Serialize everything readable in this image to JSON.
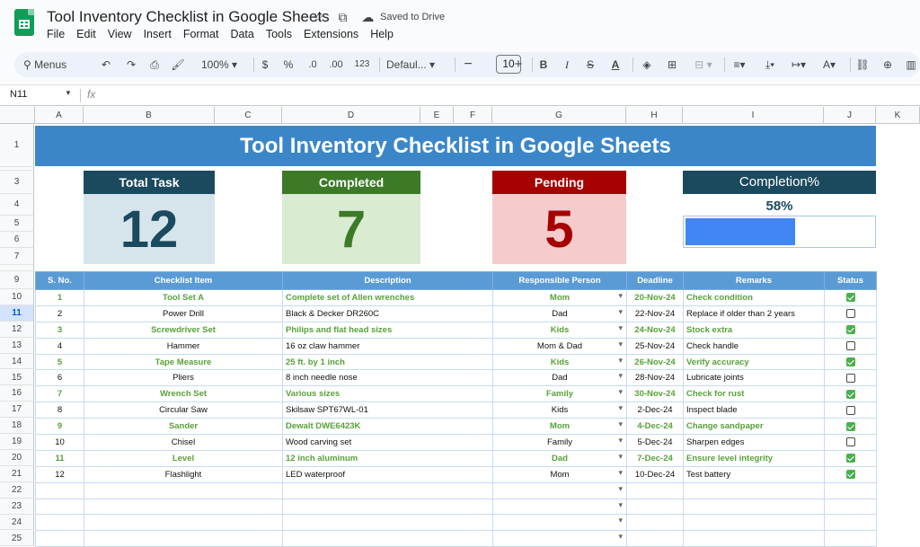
{
  "app": {
    "doc_title": "Tool Inventory Checklist in Google Sheets",
    "saved_status": "Saved to Drive",
    "menu": [
      "File",
      "Edit",
      "View",
      "Insert",
      "Format",
      "Data",
      "Tools",
      "Extensions",
      "Help"
    ]
  },
  "toolbar": {
    "menus_label": "Menus",
    "zoom": "100%",
    "currency": "$",
    "percent": "%",
    "dec_decrease": ".0",
    "dec_increase": ".00",
    "number_format": "123",
    "font": "Defaul...",
    "font_size": "10",
    "bold": "B",
    "italic": "I",
    "strike": "S",
    "text_color": "A"
  },
  "formula_bar": {
    "cell_ref": "N11",
    "fx": "fx"
  },
  "columns": [
    "A",
    "B",
    "C",
    "D",
    "E",
    "F",
    "G",
    "H",
    "I",
    "J",
    "K"
  ],
  "rows": [
    "1",
    "2",
    "3",
    "4",
    "5",
    "6",
    "7",
    "8",
    "9",
    "10",
    "11",
    "12",
    "13",
    "14",
    "15",
    "16",
    "17",
    "18",
    "19",
    "20",
    "21",
    "22",
    "23",
    "24",
    "25"
  ],
  "selected_row": "11",
  "banner_title": "Tool Inventory Checklist in Google Sheets",
  "kpis": {
    "total": {
      "label": "Total Task",
      "value": "12",
      "header_color": "#1b4a5e",
      "bg": "#d6e5ec",
      "value_color": "#1b4a5e"
    },
    "completed": {
      "label": "Completed",
      "value": "7",
      "header_color": "#3c7a28",
      "bg": "#d9ecd2",
      "value_color": "#3c7a28"
    },
    "pending": {
      "label": "Pending",
      "value": "5",
      "header_color": "#a60000",
      "bg": "#f4cccc",
      "value_color": "#a60000"
    },
    "completion": {
      "label": "Completion%",
      "value": "58%",
      "fraction": 0.58,
      "header_color": "#1b4a5e"
    }
  },
  "table": {
    "headers": [
      "S. No.",
      "Checklist Item",
      "Description",
      "Responsible Person",
      "Deadline",
      "Remarks",
      "Status"
    ],
    "rows": [
      {
        "sno": "1",
        "item": "Tool Set A",
        "desc": "Complete set of Allen wrenches",
        "person": "Mom",
        "deadline": "20-Nov-24",
        "remarks": "Check condition",
        "done": true
      },
      {
        "sno": "2",
        "item": "Power Drill",
        "desc": "Black & Decker DR260C",
        "person": "Dad",
        "deadline": "22-Nov-24",
        "remarks": "Replace if older than 2 years",
        "done": false
      },
      {
        "sno": "3",
        "item": "Screwdriver Set",
        "desc": "Philips and flat head sizes",
        "person": "Kids",
        "deadline": "24-Nov-24",
        "remarks": "Stock extra",
        "done": true
      },
      {
        "sno": "4",
        "item": "Hammer",
        "desc": "16 oz claw hammer",
        "person": "Mom & Dad",
        "deadline": "25-Nov-24",
        "remarks": "Check handle",
        "done": false
      },
      {
        "sno": "5",
        "item": "Tape Measure",
        "desc": "25 ft. by 1 inch",
        "person": "Kids",
        "deadline": "26-Nov-24",
        "remarks": "Verify accuracy",
        "done": true
      },
      {
        "sno": "6",
        "item": "Pliers",
        "desc": "8 inch needle nose",
        "person": "Dad",
        "deadline": "28-Nov-24",
        "remarks": "Lubricate joints",
        "done": false
      },
      {
        "sno": "7",
        "item": "Wrench Set",
        "desc": "Various sizes",
        "person": "Family",
        "deadline": "30-Nov-24",
        "remarks": "Check for rust",
        "done": true
      },
      {
        "sno": "8",
        "item": "Circular Saw",
        "desc": "Skilsaw SPT67WL-01",
        "person": "Kids",
        "deadline": "2-Dec-24",
        "remarks": "Inspect blade",
        "done": false
      },
      {
        "sno": "9",
        "item": "Sander",
        "desc": "Dewalt DWE6423K",
        "person": "Mom",
        "deadline": "4-Dec-24",
        "remarks": "Change sandpaper",
        "done": true
      },
      {
        "sno": "10",
        "item": "Chisel",
        "desc": "Wood carving set",
        "person": "Family",
        "deadline": "5-Dec-24",
        "remarks": "Sharpen edges",
        "done": false
      },
      {
        "sno": "11",
        "item": "Level",
        "desc": "12 inch aluminum",
        "person": "Dad",
        "deadline": "7-Dec-24",
        "remarks": "Ensure level integrity",
        "done": true
      },
      {
        "sno": "12",
        "item": "Flashlight",
        "desc": "LED waterproof",
        "person": "Mom",
        "deadline": "10-Dec-24",
        "remarks": "Test battery",
        "done": true
      }
    ],
    "empty_rows": 4
  }
}
